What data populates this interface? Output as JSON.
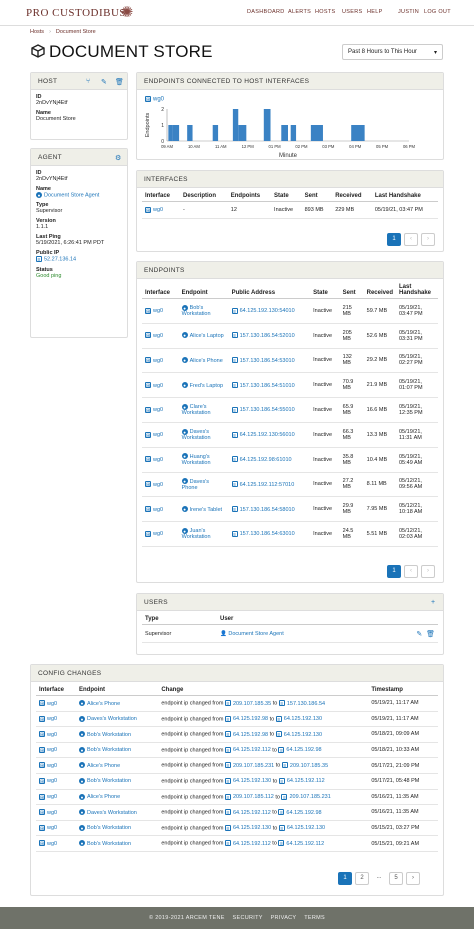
{
  "brand": {
    "name": "PRO CUSTODIBUS"
  },
  "nav": {
    "dashboard": "DASHBOARD",
    "alerts": "ALERTS",
    "hosts": "HOSTS",
    "users": "USERS",
    "help": "HELP",
    "user": "JUSTIN",
    "logout": "LOG OUT"
  },
  "breadcrumb": {
    "root": "Hosts",
    "current": "Document Store"
  },
  "page": {
    "title": "DOCUMENT STORE",
    "range": "Past 8 Hours to This Hour"
  },
  "host": {
    "header": "HOST",
    "id_label": "ID",
    "id": "2nDvYNj4Etf",
    "name_label": "Name",
    "name": "Document Store"
  },
  "agent": {
    "header": "AGENT",
    "id_label": "ID",
    "id": "2nDvYNj4Etf",
    "name_label": "Name",
    "name": "Document Store Agent",
    "type_label": "Type",
    "type": "Supervisor",
    "version_label": "Version",
    "version": "1.1.1",
    "ping_label": "Last Ping",
    "ping": "5/19/2021, 6:26:41 PM PDT",
    "ip_label": "Public IP",
    "ip": "52.27.136.14",
    "status_label": "Status",
    "status": "Good ping"
  },
  "chart_card": {
    "header": "ENDPOINTS CONNECTED TO HOST INTERFACES",
    "iface": "wg0"
  },
  "chart_data": {
    "type": "bar",
    "title": "",
    "ylabel": "Endpoints",
    "xlabel": "Minute",
    "ylim": [
      0,
      2
    ],
    "yticks": [
      0,
      1,
      2
    ],
    "xticks": [
      "09 AM",
      "10 AM",
      "11 AM",
      "12 PM",
      "01 PM",
      "02 PM",
      "03 PM",
      "04 PM",
      "05 PM",
      "06 PM"
    ],
    "bars": [
      {
        "x": 0.05,
        "w": 0.15,
        "v": 1
      },
      {
        "x": 0.2,
        "w": 0.25,
        "v": 1
      },
      {
        "x": 0.75,
        "w": 0.2,
        "v": 1
      },
      {
        "x": 1.7,
        "w": 0.2,
        "v": 1
      },
      {
        "x": 2.45,
        "w": 0.2,
        "v": 2
      },
      {
        "x": 2.65,
        "w": 0.3,
        "v": 1
      },
      {
        "x": 3.6,
        "w": 0.25,
        "v": 2
      },
      {
        "x": 4.25,
        "w": 0.25,
        "v": 1
      },
      {
        "x": 4.6,
        "w": 0.2,
        "v": 1
      },
      {
        "x": 5.35,
        "w": 0.45,
        "v": 1
      },
      {
        "x": 6.85,
        "w": 0.5,
        "v": 1
      }
    ]
  },
  "interfaces": {
    "header": "INTERFACES",
    "cols": [
      "Interface",
      "Description",
      "Endpoints",
      "State",
      "Sent",
      "Received",
      "Last Handshake"
    ],
    "rows": [
      [
        "wg0",
        "-",
        "12",
        "Inactive",
        "893 MB",
        "229 MB",
        "05/19/21, 03:47 PM"
      ]
    ]
  },
  "endpoints": {
    "header": "ENDPOINTS",
    "cols": [
      "Interface",
      "Endpoint",
      "Public Address",
      "State",
      "Sent",
      "Received",
      "Last Handshake"
    ],
    "rows": [
      [
        "wg0",
        "Bob's Workstation",
        "64.125.192.130:54010",
        "Inactive",
        "215 MB",
        "59.7 MB",
        "05/19/21, 03:47 PM"
      ],
      [
        "wg0",
        "Alice's Laptop",
        "157.130.186.54:52010",
        "Inactive",
        "205 MB",
        "52.6 MB",
        "05/19/21, 03:31 PM"
      ],
      [
        "wg0",
        "Alice's Phone",
        "157.130.186.54:53010",
        "Inactive",
        "132 MB",
        "29.2 MB",
        "05/19/21, 02:27 PM"
      ],
      [
        "wg0",
        "Fred's Laptop",
        "157.130.186.54:51010",
        "Inactive",
        "70.9 MB",
        "21.9 MB",
        "05/19/21, 01:07 PM"
      ],
      [
        "wg0",
        "Clare's Workstation",
        "157.130.186.54:55010",
        "Inactive",
        "65.9 MB",
        "16.6 MB",
        "05/19/21, 12:35 PM"
      ],
      [
        "wg0",
        "Daves's Workstation",
        "64.125.192.130:56010",
        "Inactive",
        "66.3 MB",
        "13.3 MB",
        "05/19/21, 11:31 AM"
      ],
      [
        "wg0",
        "Huang's Workstation",
        "64.125.192.98:61010",
        "Inactive",
        "35.8 MB",
        "10.4 MB",
        "05/19/21, 05:49 AM"
      ],
      [
        "wg0",
        "Daves's Phone",
        "64.125.192.112:57010",
        "Inactive",
        "27.2 MB",
        "8.11 MB",
        "05/12/21, 09:56 AM"
      ],
      [
        "wg0",
        "Irene's Tablet",
        "157.130.186.54:58010",
        "Inactive",
        "29.9 MB",
        "7.95 MB",
        "05/12/21, 10:18 AM"
      ],
      [
        "wg0",
        "Juan's Workstation",
        "157.130.186.54:63010",
        "Inactive",
        "24.5 MB",
        "5.51 MB",
        "05/12/21, 02:03 AM"
      ]
    ]
  },
  "users": {
    "header": "USERS",
    "cols": [
      "Type",
      "User"
    ],
    "rows": [
      [
        "Supervisor",
        "Document Store Agent"
      ]
    ]
  },
  "changes": {
    "header": "CONFIG CHANGES",
    "cols": [
      "Interface",
      "Endpoint",
      "Change",
      "Timestamp"
    ],
    "prefix": "endpoint ip changed from",
    "to": "to",
    "rows": [
      [
        "wg0",
        "Alice's Phone",
        "209.107.185.35",
        "157.130.186.54",
        "05/19/21, 11:17 AM"
      ],
      [
        "wg0",
        "Daves's Workstation",
        "64.125.192.98",
        "64.125.192.130",
        "05/19/21, 11:17 AM"
      ],
      [
        "wg0",
        "Bob's Workstation",
        "64.125.192.98",
        "64.125.192.130",
        "05/18/21, 09:09 AM"
      ],
      [
        "wg0",
        "Bob's Workstation",
        "64.125.192.112",
        "64.125.192.98",
        "05/18/21, 10:33 AM"
      ],
      [
        "wg0",
        "Alice's Phone",
        "209.107.185.231",
        "209.107.185.35",
        "05/17/21, 21:09 PM"
      ],
      [
        "wg0",
        "Bob's Workstation",
        "64.125.192.130",
        "64.125.192.112",
        "05/17/21, 05:48 PM"
      ],
      [
        "wg0",
        "Alice's Phone",
        "209.107.185.112",
        "209.107.185.231",
        "05/16/21, 11:35 AM"
      ],
      [
        "wg0",
        "Daves's Workstation",
        "64.125.192.112",
        "64.125.192.98",
        "05/16/21, 11:35 AM"
      ],
      [
        "wg0",
        "Bob's Workstation",
        "64.125.192.130",
        "64.125.192.130",
        "05/15/21, 03:27 PM"
      ],
      [
        "wg0",
        "Bob's Workstation",
        "64.125.192.112",
        "64.125.192.112",
        "05/15/21, 09:21 AM"
      ]
    ]
  },
  "pager": {
    "active": "1",
    "two": "2",
    "dots": "...",
    "five": "5",
    "prev": "‹",
    "next": "›"
  },
  "footer": {
    "copy": "© 2019-2021 ARCEM TENE",
    "security": "SECURITY",
    "privacy": "PRIVACY",
    "terms": "TERMS"
  }
}
